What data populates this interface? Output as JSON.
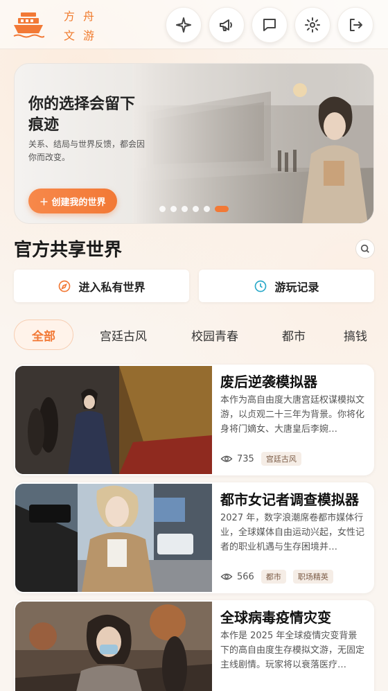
{
  "app": {
    "logo_chars": [
      "方",
      "舟",
      "文",
      "游"
    ],
    "brand_color": "#f27936"
  },
  "header_buttons": [
    {
      "icon": "sparkle-icon"
    },
    {
      "icon": "megaphone-icon"
    },
    {
      "icon": "chat-icon"
    },
    {
      "icon": "gear-icon"
    },
    {
      "icon": "logout-icon"
    }
  ],
  "banner": {
    "title": "你的选择会留下痕迹",
    "subtitle": "关系、结局与世界反馈，都会因你而改变。",
    "create_label": "＋ 创建我的世界",
    "slides_total": 6,
    "active_slide": 6
  },
  "section": {
    "title": "官方共享世界"
  },
  "actions": {
    "private_world": "进入私有世界",
    "history": "游玩记录"
  },
  "tabs": [
    "全部",
    "宫廷古风",
    "校园青春",
    "都市",
    "搞钱"
  ],
  "cards": [
    {
      "title": "废后逆袭模拟器",
      "desc": "本作为高自由度大唐宫廷权谋模拟文游，以贞观二十三年为背景。你将化身将门嫡女、大唐皇后李婉…",
      "views": "735",
      "tags": [
        "宫廷古风"
      ]
    },
    {
      "title": "都市女记者调查模拟器",
      "desc": "2027 年，数字浪潮席卷都市媒体行业，全球媒体自由运动兴起，女性记者的职业机遇与生存困境并…",
      "views": "566",
      "tags": [
        "都市",
        "职场精英"
      ]
    },
    {
      "title": "全球病毒疫情灾变",
      "desc": "本作是 2025 年全球疫情灾变背景下的高自由度生存模拟文游，无固定主线剧情。玩家将以衰落医疗…",
      "views": "",
      "tags": []
    }
  ]
}
